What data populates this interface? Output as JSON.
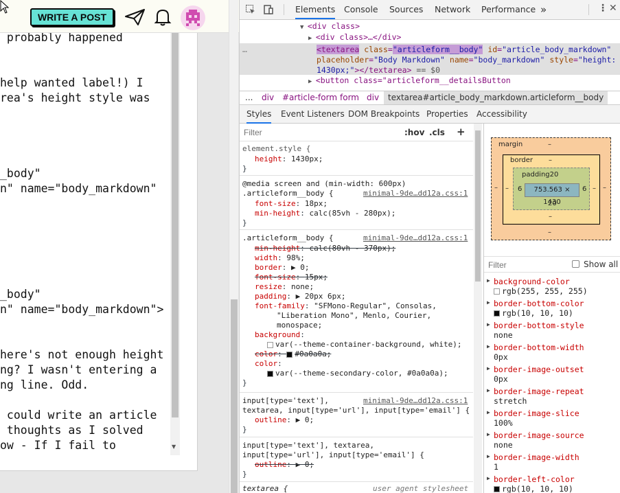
{
  "site": {
    "write_post_label": "WRITE A POST",
    "editor_lines": [
      " probably happened",
      "",
      "",
      "help wanted label!) I",
      "rea's height style was",
      "",
      "",
      "",
      "",
      "_body\"",
      "n\" name=\"body_markdown\"",
      "",
      "",
      "",
      "",
      "",
      "",
      "_body\"",
      "n\" name=\"body_markdown\">",
      "",
      "",
      "here's not enough height",
      "ng? I wasn't entering a",
      "ng line. Odd.",
      "",
      " could write an article",
      " thoughts as I solved",
      "ow - If I fail to"
    ]
  },
  "devtools": {
    "tabs": [
      "Elements",
      "Console",
      "Sources",
      "Network",
      "Performance"
    ],
    "more_tabs": "»",
    "active_tab": "Elements",
    "tree": {
      "line1_tag": "<div class>",
      "line2": "<div class>…</div>",
      "sel_open": "<textarea",
      "sel_attr1": "class",
      "sel_val1": "\"articleform__body\"",
      "sel_attr2": "id",
      "sel_val2": "\"article_body_markdown\"",
      "sel_attr3": "placeholder",
      "sel_val3": "\"Body Markdown\"",
      "sel_attr4": "name",
      "sel_val4": "\"body_markdown\"",
      "sel_attr5": "style",
      "sel_val5": "\"height:",
      "sel_val5b": "1430px;\"",
      "sel_close": "></textarea>",
      "sel_eq": " == $0",
      "next_line": "<button class=\"articleform__detailsButton"
    },
    "breadcrumbs": [
      "...",
      "div",
      "#article-form",
      "form",
      "div",
      "textarea#article_body_markdown.articleform__body"
    ],
    "subtabs": [
      "Styles",
      "Event Listeners",
      "DOM Breakpoints",
      "Properties",
      "Accessibility"
    ],
    "styles": {
      "filter_placeholder": "Filter",
      "hov": ":hov",
      "cls": ".cls",
      "plus": "+",
      "rule1_sel": "element.style {",
      "rule1_p1": "height",
      "rule1_v1": "1430px;",
      "rule2_media": "@media screen and (min-width: 600px)",
      "rule2_sel": ".articleform__body {",
      "rule2_src": "minimal-9de…dd12a.css:1",
      "rule2_p1": "font-size",
      "rule2_v1": "18px;",
      "rule2_p2": "min-height",
      "rule2_v2": "calc(85vh - 280px);",
      "rule3_sel": ".articleform__body {",
      "rule3_src": "minimal-9de…dd12a.css:1",
      "rule3_lines": [
        {
          "p": "min-height",
          "v": "calc(80vh - 370px);",
          "strike": true
        },
        {
          "p": "width",
          "v": "98%;",
          "strike": false
        },
        {
          "p": "border",
          "v": "▶ 0;",
          "strike": false
        },
        {
          "p": "font-size",
          "v": "15px;",
          "strike": true
        },
        {
          "p": "resize",
          "v": "none;",
          "strike": false
        },
        {
          "p": "padding",
          "v": "▶ 20px 6px;",
          "strike": false
        },
        {
          "p": "font-family",
          "v": "\"SFMono-Regular\", Consolas,",
          "strike": false
        }
      ],
      "rule3_ff2": "\"Liberation Mono\", Menlo, Courier,",
      "rule3_ff3": "monospace;",
      "rule3_bg": "background",
      "rule3_bg_val": "var(--theme-container-background, white);",
      "rule3_color1": "color",
      "rule3_color1_val": "#0a0a0a;",
      "rule3_color2": "color",
      "rule3_color2_val": "var(--theme-secondary-color, #0a0a0a);",
      "rule4_sel1": "input[type='text'],",
      "rule4_src": "minimal-9de…dd12a.css:1",
      "rule4_sel2": "textarea, input[type='url'], input[type='email'] {",
      "rule4_p": "outline",
      "rule4_v": "▶ 0;",
      "rule5_sel1": "input[type='text'], textarea,",
      "rule5_sel2": "input[type='url'], input[type='email'] {",
      "rule5_p": "outline",
      "rule5_v": "▶ 0;",
      "rule6_sel": "textarea {",
      "rule6_src": "user agent stylesheet"
    },
    "boxmodel": {
      "margin_label": "margin",
      "border_label": "border",
      "padding_label": "padding20",
      "content": "753.563 × 1430",
      "margin_top": "–",
      "margin_bottom": "–",
      "margin_left": "–",
      "margin_right": "–",
      "border_top": "–",
      "border_bottom": "–",
      "border_left": "–",
      "border_right": "–",
      "padding_left": "6",
      "padding_right": "6",
      "padding_bottom": "20"
    },
    "computed": {
      "filter_placeholder": "Filter",
      "show_all": "Show all",
      "props": [
        {
          "name": "background-color",
          "value": "rgb(255, 255, 255)",
          "swatch": "#ffffff"
        },
        {
          "name": "border-bottom-color",
          "value": "rgb(10, 10, 10)",
          "swatch": "#0a0a0a"
        },
        {
          "name": "border-bottom-style",
          "value": "none"
        },
        {
          "name": "border-bottom-width",
          "value": "0px"
        },
        {
          "name": "border-image-outset",
          "value": "0px"
        },
        {
          "name": "border-image-repeat",
          "value": "stretch"
        },
        {
          "name": "border-image-slice",
          "value": "100%"
        },
        {
          "name": "border-image-source",
          "value": "none"
        },
        {
          "name": "border-image-width",
          "value": "1"
        },
        {
          "name": "border-left-color",
          "value": "rgb(10, 10, 10)",
          "swatch": "#0a0a0a"
        }
      ]
    }
  },
  "colors": {
    "accent": "#66e2d5",
    "tab_underline": "#1a73e8",
    "tag": "#881280",
    "attr": "#994500",
    "prop": "#c80000"
  }
}
